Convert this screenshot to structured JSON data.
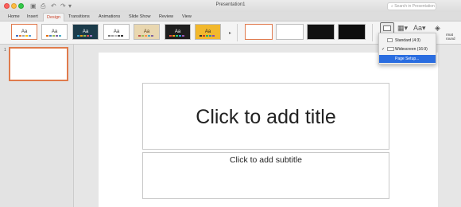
{
  "window": {
    "title": "Presentation1"
  },
  "search": {
    "placeholder": "Search in Presentation"
  },
  "tabs": [
    {
      "label": "Home"
    },
    {
      "label": "Insert"
    },
    {
      "label": "Design"
    },
    {
      "label": "Transitions"
    },
    {
      "label": "Animations"
    },
    {
      "label": "Slide Show"
    },
    {
      "label": "Review"
    },
    {
      "label": "View"
    }
  ],
  "themes": [
    {
      "label": "Aa",
      "bg": "#ffffff",
      "fg": "#333333",
      "selected": true
    },
    {
      "label": "Aa",
      "bg": "#ffffff",
      "fg": "#333333",
      "selected": false
    },
    {
      "label": "Aa",
      "bg": "#1b3b4a",
      "fg": "#ffffff",
      "selected": false
    },
    {
      "label": "Aa",
      "bg": "#ffffff",
      "fg": "#333333",
      "selected": false
    },
    {
      "label": "Aa",
      "bg": "#e9d7b0",
      "fg": "#5a3a10",
      "selected": false
    },
    {
      "label": "Aa",
      "bg": "#1e1e1e",
      "fg": "#ffffff",
      "selected": false
    },
    {
      "label": "Aa",
      "bg": "#f2b82c",
      "fg": "#222222",
      "selected": false
    }
  ],
  "slide_size_menu": {
    "items": [
      {
        "label": "Standard (4:3)",
        "checked": false
      },
      {
        "label": "Widescreen (16:9)",
        "checked": true
      },
      {
        "label": "Page Setup...",
        "highlighted": true
      }
    ]
  },
  "format_background": {
    "label": "rmat\nround"
  },
  "slides": [
    {
      "number": "1"
    }
  ],
  "slide": {
    "title_placeholder": "Click to add title",
    "subtitle_placeholder": "Click to add subtitle"
  },
  "colors": {
    "accent": "#c9452c",
    "selection": "#e07b4c",
    "menu_highlight": "#2a6de0"
  }
}
